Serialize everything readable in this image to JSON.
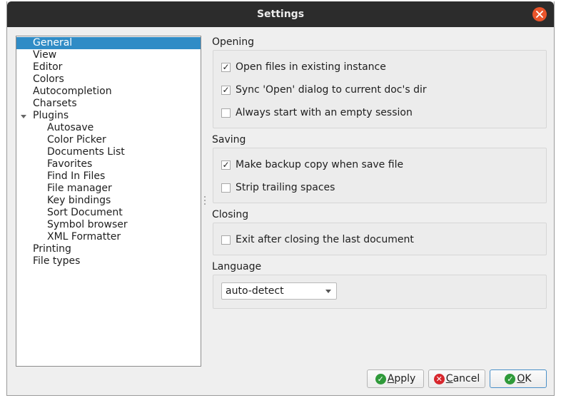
{
  "window": {
    "title": "Settings"
  },
  "tree": {
    "items": [
      {
        "label": "General",
        "level": 0,
        "selected": true
      },
      {
        "label": "View",
        "level": 0
      },
      {
        "label": "Editor",
        "level": 0
      },
      {
        "label": "Colors",
        "level": 0
      },
      {
        "label": "Autocompletion",
        "level": 0
      },
      {
        "label": "Charsets",
        "level": 0
      },
      {
        "label": "Plugins",
        "level": 0,
        "expanded": true
      },
      {
        "label": "Autosave",
        "level": 1
      },
      {
        "label": "Color Picker",
        "level": 1
      },
      {
        "label": "Documents List",
        "level": 1
      },
      {
        "label": "Favorites",
        "level": 1
      },
      {
        "label": "Find In Files",
        "level": 1
      },
      {
        "label": "File manager",
        "level": 1
      },
      {
        "label": "Key bindings",
        "level": 1
      },
      {
        "label": "Sort Document",
        "level": 1
      },
      {
        "label": "Symbol browser",
        "level": 1
      },
      {
        "label": "XML Formatter",
        "level": 1
      },
      {
        "label": "Printing",
        "level": 0
      },
      {
        "label": "File types",
        "level": 0
      }
    ]
  },
  "opening": {
    "label": "Opening",
    "options": [
      {
        "label": "Open files in existing instance",
        "checked": true
      },
      {
        "label": "Sync 'Open' dialog to current doc's dir",
        "checked": true
      },
      {
        "label": "Always start with an empty session",
        "checked": false
      }
    ]
  },
  "saving": {
    "label": "Saving",
    "options": [
      {
        "label": "Make backup copy when save file",
        "checked": true
      },
      {
        "label": "Strip trailing spaces",
        "checked": false
      }
    ]
  },
  "closing": {
    "label": "Closing",
    "options": [
      {
        "label": "Exit after closing the last document",
        "checked": false
      }
    ]
  },
  "language": {
    "label": "Language",
    "selected": "auto-detect"
  },
  "buttons": {
    "apply": {
      "pre": "",
      "mnemonic": "A",
      "post": "pply",
      "icon": "check-icon"
    },
    "cancel": {
      "pre": "",
      "mnemonic": "C",
      "post": "ancel",
      "icon": "cross-icon"
    },
    "ok": {
      "pre": "",
      "mnemonic": "O",
      "post": "K",
      "icon": "check-icon"
    }
  },
  "colors": {
    "titlebar": "#2c2c2c",
    "close": "#e9542b",
    "selection": "#308cc6",
    "ok_icon": "#2f9a3a",
    "cancel_icon": "#d7262c"
  }
}
